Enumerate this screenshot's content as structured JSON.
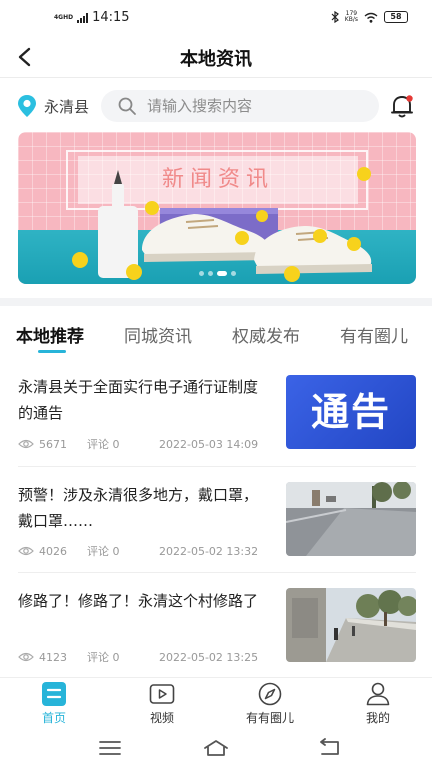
{
  "status_bar": {
    "network": "4GHD",
    "time": "14:15",
    "speed_value": "179",
    "speed_unit": "KB/s",
    "battery": "58"
  },
  "header": {
    "title": "本地资讯",
    "back_icon": "arrow-left-icon"
  },
  "search_row": {
    "location": "永清县",
    "placeholder": "请输入搜索内容",
    "bell_has_badge": true
  },
  "banner": {
    "title": "新闻资讯",
    "page_count": 4,
    "active_page": 2
  },
  "tabs": [
    {
      "label": "本地推荐",
      "active": true
    },
    {
      "label": "同城资讯",
      "active": false
    },
    {
      "label": "权威发布",
      "active": false
    },
    {
      "label": "有有圈儿",
      "active": false
    }
  ],
  "news": [
    {
      "title": "永清县关于全面实行电子通行证制度的通告",
      "views": "5671",
      "comments": "评论 0",
      "date": "2022-05-03 14:09",
      "thumb_text": "通告",
      "thumb_kind": "notice"
    },
    {
      "title": "预警！涉及永清很多地方，戴口罩，戴口罩……",
      "views": "4026",
      "comments": "评论 0",
      "date": "2022-05-02 13:32",
      "thumb_kind": "road-photo"
    },
    {
      "title": "修路了！修路了！永清这个村修路了",
      "views": "4123",
      "comments": "评论 0",
      "date": "2022-05-02 13:25",
      "thumb_kind": "village-road-photo"
    }
  ],
  "bottom_nav": [
    {
      "label": "首页",
      "icon": "home-icon",
      "active": true
    },
    {
      "label": "视频",
      "icon": "video-icon",
      "active": false
    },
    {
      "label": "有有圈儿",
      "icon": "compass-icon",
      "active": false
    },
    {
      "label": "我的",
      "icon": "user-icon",
      "active": false
    }
  ],
  "colors": {
    "accent": "#27b4d9",
    "bell_badge": "#e53935",
    "notice_blue": "#2f55d9"
  }
}
